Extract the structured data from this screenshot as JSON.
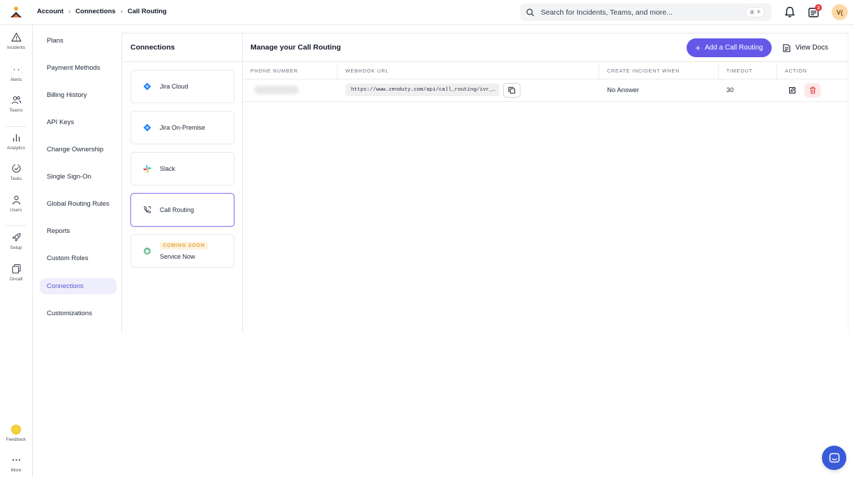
{
  "header": {
    "breadcrumb": [
      "Account",
      "Connections",
      "Call Routing"
    ],
    "search_placeholder": "Search for Incidents, Teams, and more...",
    "search_shortcut_key": "K",
    "notification_count": "3",
    "avatar_initials": "V("
  },
  "rail": {
    "items": [
      {
        "label": "Incidents",
        "icon": "warning-triangle-icon"
      },
      {
        "label": "Alerts",
        "icon": "braces-icon"
      },
      {
        "label": "Teams",
        "icon": "team-icon"
      },
      {
        "label": "Analytics",
        "icon": "bar-chart-icon"
      },
      {
        "label": "Tasks",
        "icon": "task-check-icon"
      },
      {
        "label": "Users",
        "icon": "user-icon"
      },
      {
        "label": "Setup",
        "icon": "rocket-icon"
      },
      {
        "label": "Oncall",
        "icon": "oncall-icon"
      }
    ],
    "feedback_label": "Feedback",
    "more_label": "More"
  },
  "settings_menu": {
    "items": [
      "Plans",
      "Payment Methods",
      "Billing History",
      "API Keys",
      "Change Ownership",
      "Single Sign-On",
      "Global Routing Rules",
      "Reports",
      "Custom Roles",
      "Connections",
      "Customizations"
    ],
    "active": "Connections"
  },
  "connections": {
    "title": "Connections",
    "cards": [
      {
        "label": "Jira Cloud",
        "icon": "jira-icon"
      },
      {
        "label": "Jira On-Premise",
        "icon": "jira-icon"
      },
      {
        "label": "Slack",
        "icon": "slack-icon"
      },
      {
        "label": "Call Routing",
        "icon": "phone-routing-icon",
        "active": true
      },
      {
        "label": "Service Now",
        "icon": "servicenow-icon",
        "badge": "COMING SOON"
      }
    ]
  },
  "main": {
    "title": "Manage your Call Routing",
    "add_button": "Add a Call Routing",
    "docs_button": "View Docs",
    "table": {
      "headers": [
        "PHONE NUMBER",
        "WEBHOOK URL",
        "CREATE INCIDENT WHEN",
        "TIMEOUT",
        "ACTION"
      ],
      "rows": [
        {
          "webhook_url": "https://www.zenduty.com/api/call_routing/ivr_…",
          "create_incident_when": "No Answer",
          "timeout": "30"
        }
      ]
    }
  },
  "colors": {
    "accent": "#6458e8",
    "active_bg": "#eeeefc",
    "danger_bg": "#fde8e8",
    "danger": "#e53e3e"
  }
}
